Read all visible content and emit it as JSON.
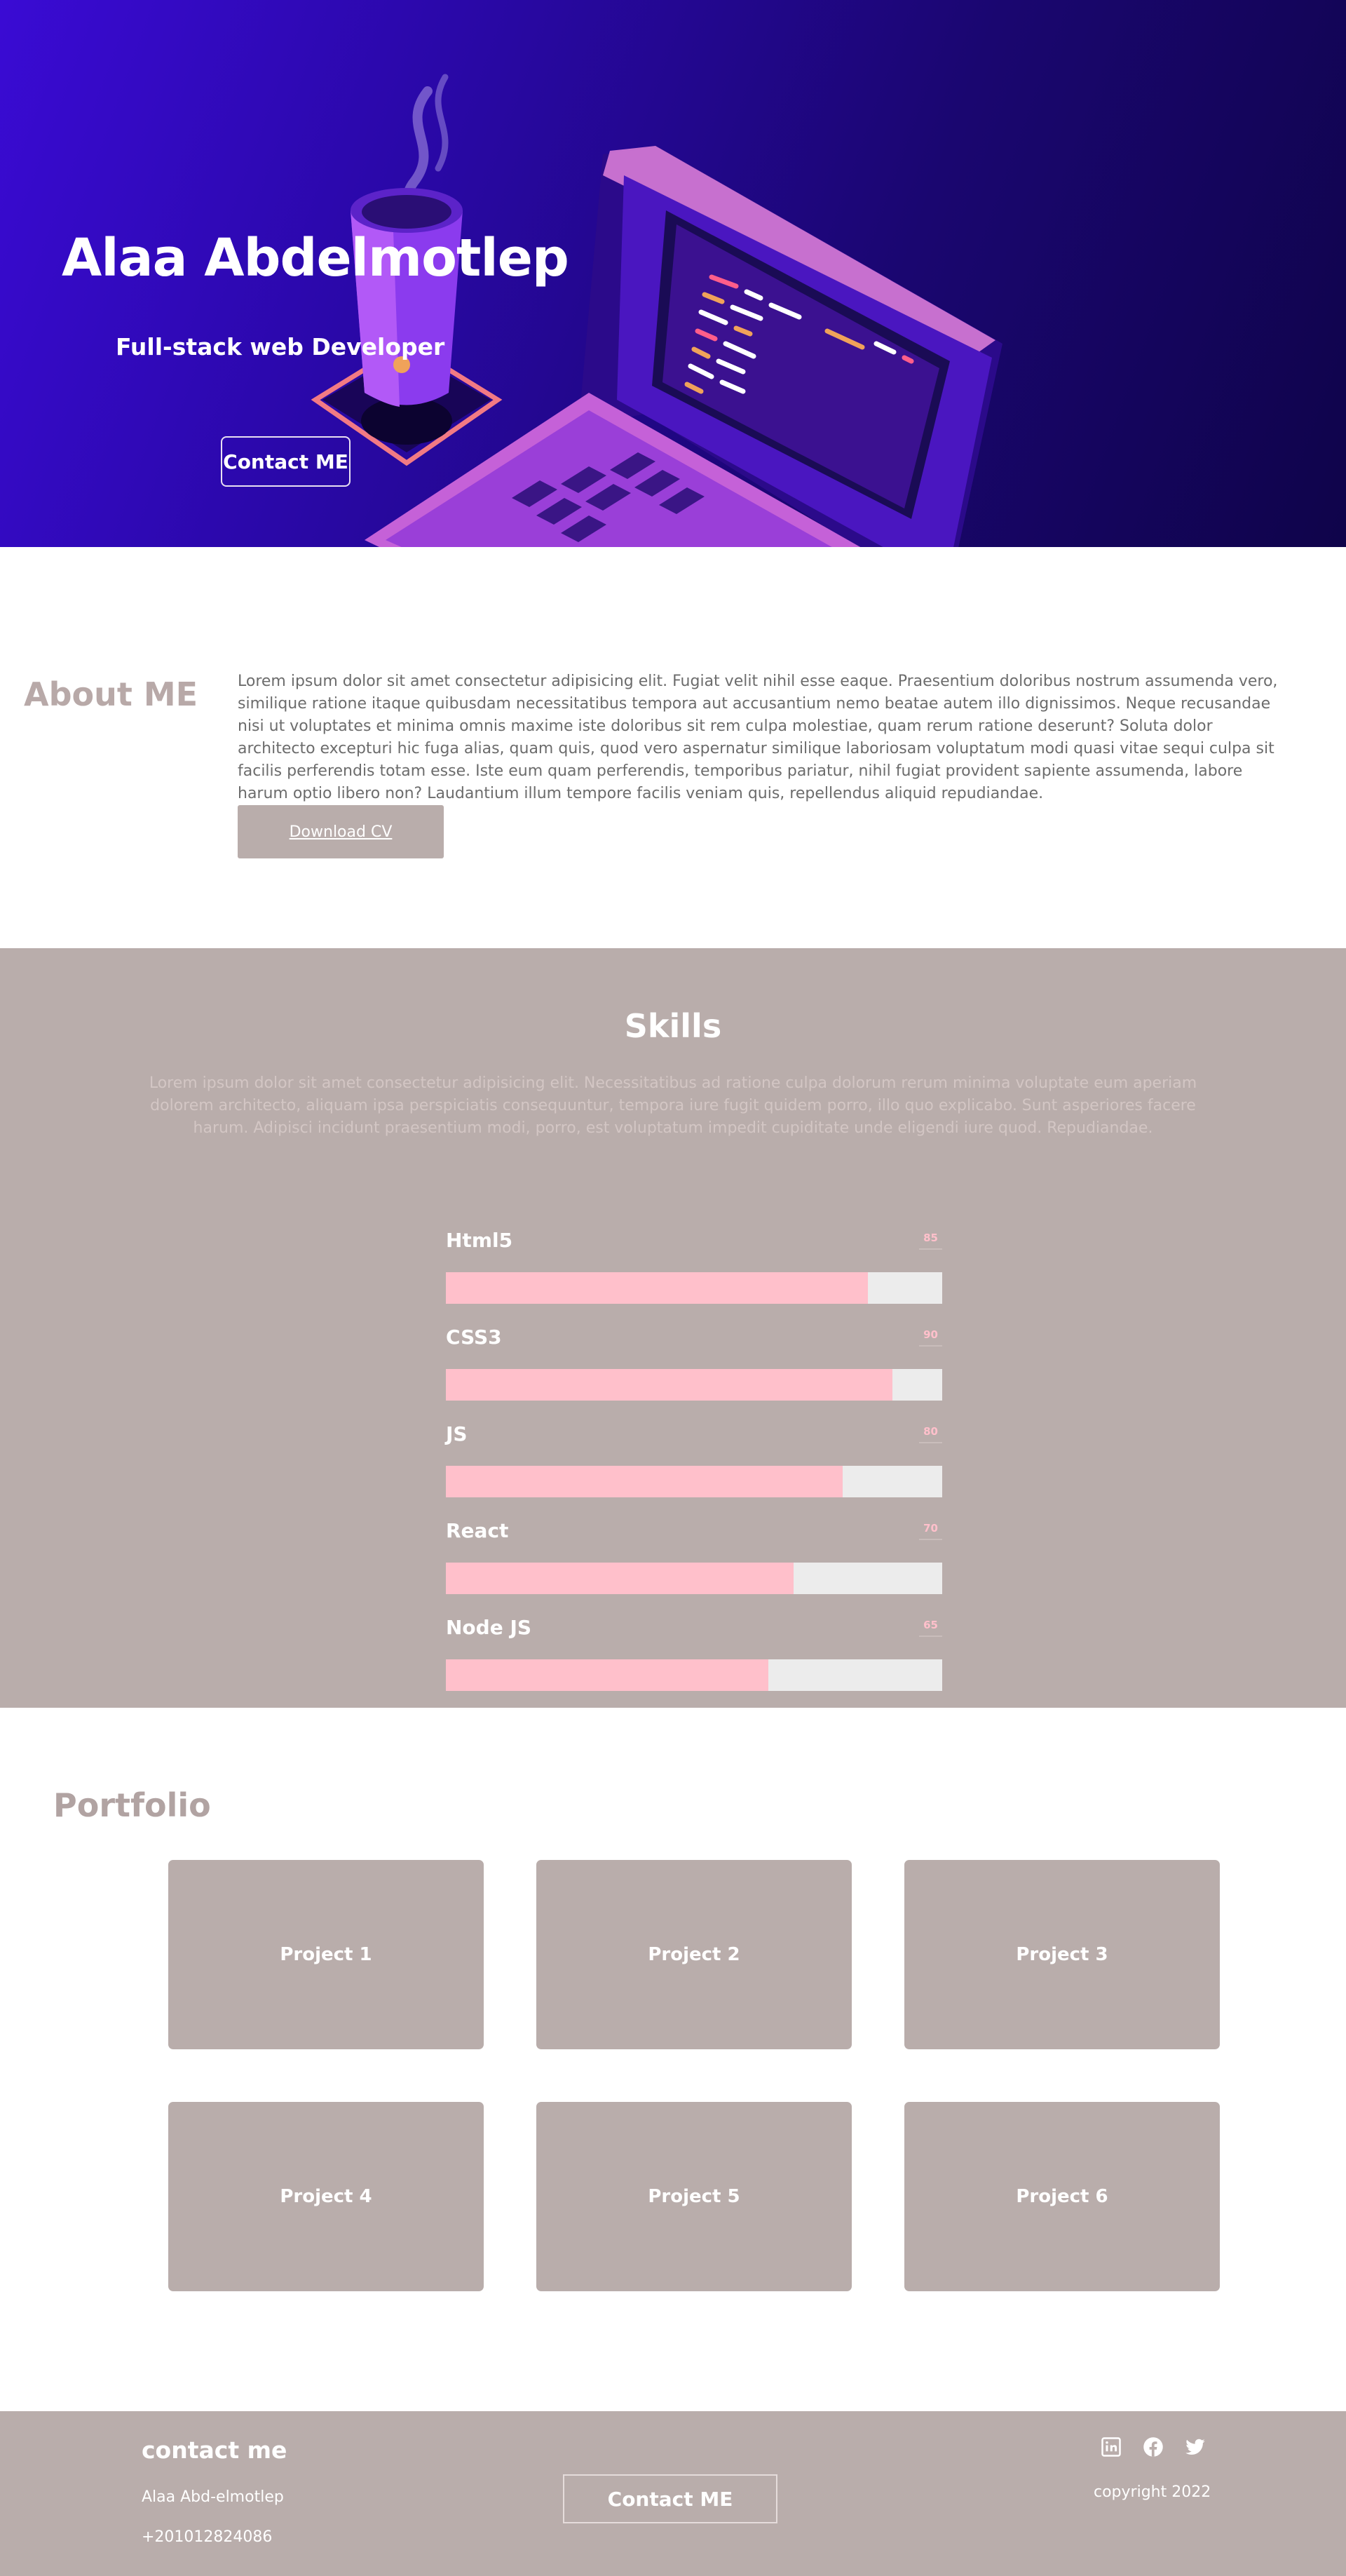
{
  "hero": {
    "title": "Alaa Abdelmotlep",
    "subtitle": "Full-stack web Developer",
    "cta_label": "Contact ME",
    "illustration": "laptop-and-coffee-cup-illustration"
  },
  "about": {
    "title": "About ME",
    "text": "Lorem ipsum dolor sit amet consectetur adipisicing elit. Fugiat velit nihil esse eaque. Praesentium doloribus nostrum assumenda vero, similique ratione itaque quibusdam necessitatibus tempora aut accusantium nemo beatae autem illo dignissimos. Neque recusandae nisi ut voluptates et minima omnis maxime iste doloribus sit rem culpa molestiae, quam rerum ratione deserunt? Soluta dolor architecto excepturi hic fuga alias, quam quis, quod vero aspernatur similique laboriosam voluptatum modi quasi vitae sequi culpa sit facilis perferendis totam esse. Iste eum quam perferendis, temporibus pariatur, nihil fugiat provident sapiente assumenda, labore harum optio libero non? Laudantium illum tempore facilis veniam quis, repellendus aliquid repudiandae.",
    "download_label": "Download CV"
  },
  "skills": {
    "title": "Skills",
    "description": "Lorem ipsum dolor sit amet consectetur adipisicing elit. Necessitatibus ad ratione culpa dolorum rerum minima voluptate eum aperiam dolorem architecto, aliquam ipsa perspiciatis consequuntur, tempora iure fugit quidem porro, illo quo explicabo. Sunt asperiores facere harum. Adipisci incidunt praesentium modi, porro, est voluptatum impedit cupiditate unde eligendi iure quod. Repudiandae.",
    "items": [
      {
        "name": "Html5",
        "percent": "85"
      },
      {
        "name": "CSS3",
        "percent": "90"
      },
      {
        "name": "JS",
        "percent": "80"
      },
      {
        "name": "React",
        "percent": "70"
      },
      {
        "name": "Node JS",
        "percent": "65"
      }
    ]
  },
  "portfolio": {
    "title": "Portfolio",
    "projects": [
      "Project 1",
      "Project 2",
      "Project 3",
      "Project 4",
      "Project 5",
      "Project 6"
    ]
  },
  "footer": {
    "heading": "contact me",
    "name": "Alaa Abd-elmotlep",
    "phone": "+201012824086",
    "cta_label": "Contact ME",
    "socials": [
      "linkedin-icon",
      "facebook-icon",
      "twitter-icon"
    ],
    "copyright": "copyright 2022"
  },
  "colors": {
    "hero_bg": "#2a08a8",
    "section_bg": "#b9adab",
    "skill_fill": "#ffc0cb",
    "skill_track": "#ececec"
  }
}
